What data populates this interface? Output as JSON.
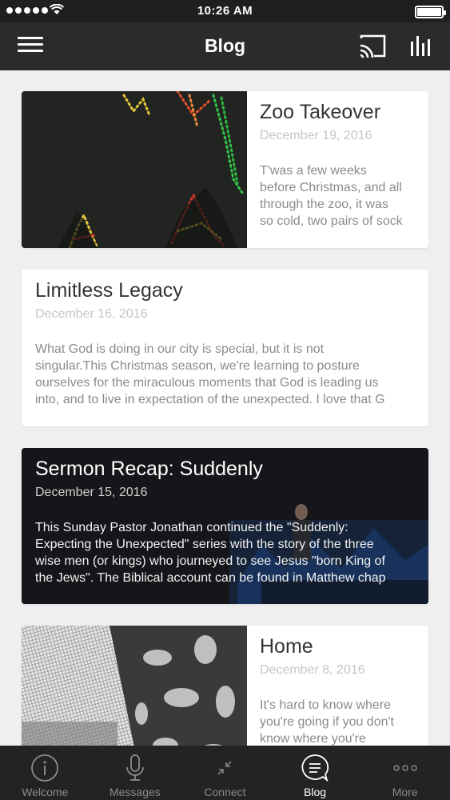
{
  "status_bar": {
    "time": "10:26 AM"
  },
  "header": {
    "title": "Blog"
  },
  "posts": [
    {
      "title": "Zoo Takeover",
      "date": "December 19, 2016",
      "excerpt_lines": [
        "T'was a few weeks",
        "before Christmas, and all",
        "through the zoo, it was",
        "so cold, two pairs of sock"
      ]
    },
    {
      "title": "Limitless Legacy",
      "date": "December 16, 2016",
      "excerpt_lines": [
        "What God is doing in our city is special, but it is not",
        "singular.This Christmas season, we're learning to posture",
        "ourselves for the miraculous moments that God is leading us",
        "into, and to live in expectation of the unexpected. I love that G"
      ]
    },
    {
      "title": "Sermon Recap: Suddenly",
      "date": "December 15, 2016",
      "excerpt_lines": [
        "This Sunday Pastor Jonathan continued the \"Suddenly:",
        "Expecting the Unexpected\" series with the story of the three",
        "wise men (or kings) who journeyed to see Jesus \"born King of",
        "the Jews\". The Biblical account can be found in Matthew chap"
      ]
    },
    {
      "title": "Home",
      "date": "December 8, 2016",
      "excerpt_lines": [
        "It's hard to know where",
        "you're going if you don't",
        "know where you're"
      ]
    }
  ],
  "tabs": [
    {
      "label": "Welcome",
      "icon": "info-icon"
    },
    {
      "label": "Messages",
      "icon": "microphone-icon"
    },
    {
      "label": "Connect",
      "icon": "collapse-arrows-icon"
    },
    {
      "label": "Blog",
      "icon": "chat-bubble-icon",
      "active": true
    },
    {
      "label": "More",
      "icon": "more-dots-icon"
    }
  ],
  "colors": {
    "header_bg": "#2b2b2b",
    "tab_bar_bg": "#232323",
    "page_bg": "#efeff1",
    "active_tab": "#ffffff",
    "inactive_tab": "#8a8a8a"
  }
}
